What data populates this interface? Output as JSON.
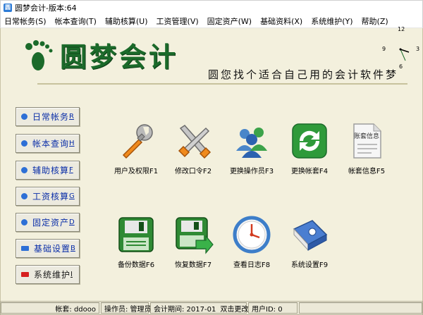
{
  "window": {
    "title": "圆梦会计-版本:64"
  },
  "menu": {
    "items": [
      "日常帐务(S)",
      "帐本查询(T)",
      "辅助核算(U)",
      "工资管理(V)",
      "固定资产(W)",
      "基础资料(X)",
      "系统维护(Y)",
      "帮助(Z)"
    ]
  },
  "banner": {
    "logo_text": "圆梦会计",
    "slogan": "圆您找个适合自己用的会计软件梦"
  },
  "clock": {
    "numbers": [
      "12",
      "3",
      "6",
      "9"
    ]
  },
  "side": {
    "items": [
      {
        "label": "日常帐务",
        "key": "R"
      },
      {
        "label": "帐本查询",
        "key": "H"
      },
      {
        "label": "辅助核算",
        "key": "F"
      },
      {
        "label": "工资核算",
        "key": "G"
      },
      {
        "label": "固定资产",
        "key": "D"
      },
      {
        "label": "基础设置",
        "key": "B"
      },
      {
        "label": "系统维护",
        "key": "I"
      }
    ]
  },
  "tools": {
    "items": [
      {
        "label": "用户及权限F1",
        "icon": "wrench-icon"
      },
      {
        "label": "修改口令F2",
        "icon": "tools-icon"
      },
      {
        "label": "更换操作员F3",
        "icon": "users-icon"
      },
      {
        "label": "更换帐套F4",
        "icon": "refresh-icon"
      },
      {
        "label": "帐套信息F5",
        "icon": "document-icon"
      },
      {
        "label": "备份数据F6",
        "icon": "floppy-icon"
      },
      {
        "label": "恢复数据F7",
        "icon": "floppy-restore-icon"
      },
      {
        "label": "查看日志F8",
        "icon": "clock-icon"
      },
      {
        "label": "系统设置F9",
        "icon": "book-settings-icon"
      }
    ],
    "doc_caption": "账套信息"
  },
  "status": {
    "account_set": "帐套: ddooo",
    "operator": "操作员: 管理员",
    "period": "会计期间: 2017-01",
    "hint": "双击更改",
    "user_id": "用户ID: 0"
  },
  "colors": {
    "main_bg": "#f3f0dd",
    "logo_green": "#1b6a2a",
    "side_text": "#0a2ea8",
    "blue_bullet": "#2d6fd6",
    "red_bullet": "#d61f1f"
  }
}
